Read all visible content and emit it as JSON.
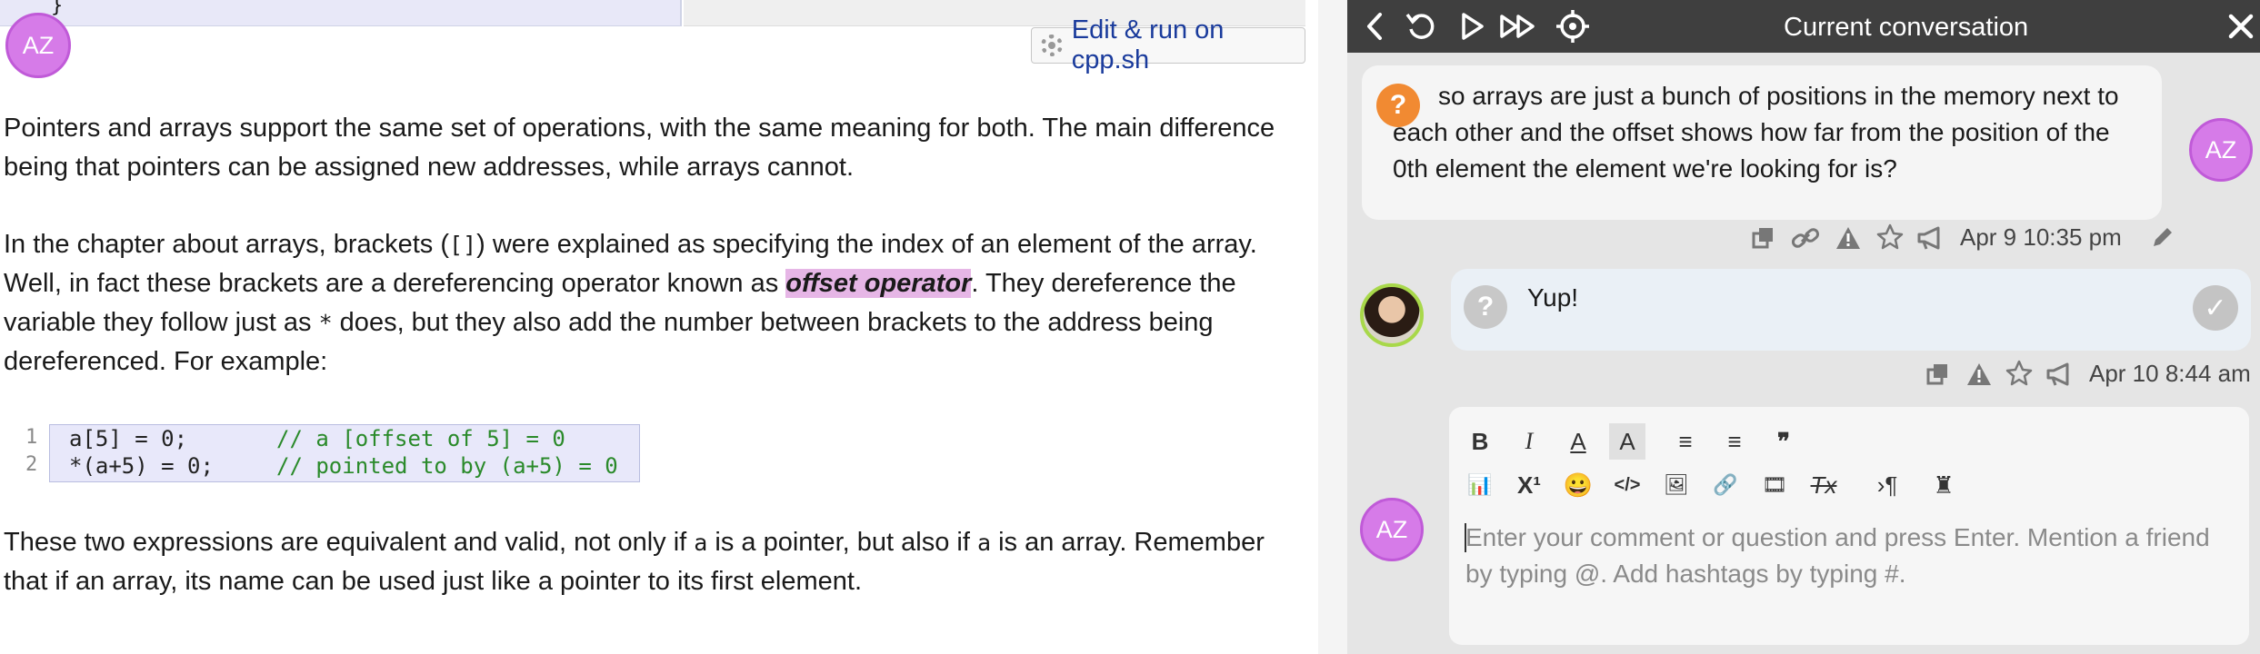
{
  "article": {
    "prev_code_tail": "}",
    "edit_run_label": "Edit & run on cpp.sh",
    "avatar_initials": "AZ",
    "para1": "Pointers and arrays support the same set of operations, with the same meaning for both. The main difference being that pointers can be assigned new addresses, while arrays cannot.",
    "para2_a": "In the chapter about arrays, brackets (",
    "para2_brackets": "[]",
    "para2_b": ") were explained as specifying the index of an element of the array. Well, in fact these brackets are a dereferencing operator known as ",
    "para2_highlight": "offset operator",
    "para2_c": ". They dereference the variable they follow just as ",
    "para2_star": "*",
    "para2_d": " does, but they also add the number between brackets to the address being dereferenced. For example:",
    "code_lines": [
      {
        "num": "1",
        "code": "a[5] = 0;",
        "comment": "// a [offset of 5] = 0"
      },
      {
        "num": "2",
        "code": "*(a+5) = 0;",
        "comment": "// pointed to by (a+5) = 0"
      }
    ],
    "para3_a": "These two expressions are equivalent and valid, not only if ",
    "para3_a_var": "a",
    "para3_b": " is a pointer, but also if ",
    "para3_b_var": "a",
    "para3_c": " is an array. Remember that if an array, its name can be used just like a pointer to its first element."
  },
  "panel": {
    "title": "Current conversation",
    "question": {
      "icon": "?",
      "text": "so arrays are just a bunch of positions in the memory next to each other and the offset shows how far from the position of the 0th element the element we're looking for is?",
      "avatar": "AZ",
      "timestamp": "Apr 9 10:35 pm"
    },
    "reply": {
      "icon": "?",
      "text": "Yup!",
      "timestamp": "Apr 10 8:44 am"
    },
    "composer": {
      "avatar": "AZ",
      "placeholder": "Enter your comment or question and press Enter. Mention a friend by typing @. Add hashtags by typing #.",
      "toolbar_row1": [
        "B",
        "I",
        "A",
        "A",
        "≡",
        "≡",
        "❞"
      ],
      "toolbar_row2": [
        "📊",
        "X¹",
        "😀",
        "</>",
        "🖼",
        "🔗",
        "🎞",
        "Tx",
        "›¶",
        "♜"
      ]
    },
    "colors": {
      "header_bg": "#3f3f3f",
      "question_badge": "#f18a32",
      "avatar": "#d67be8",
      "highlight": "#e6b6e6"
    }
  }
}
